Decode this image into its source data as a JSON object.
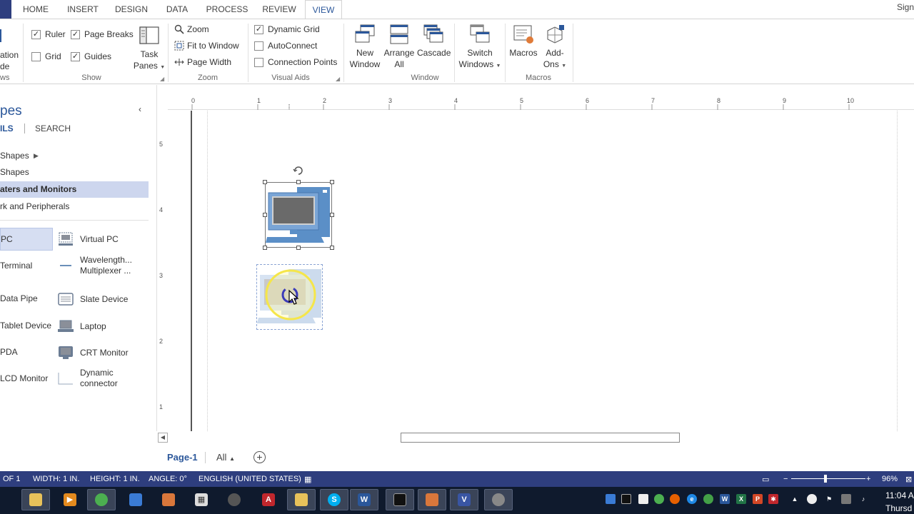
{
  "tabs": [
    {
      "label": "HOME",
      "active": false
    },
    {
      "label": "INSERT",
      "active": false
    },
    {
      "label": "DESIGN",
      "active": false
    },
    {
      "label": "DATA",
      "active": false
    },
    {
      "label": "PROCESS",
      "active": false
    },
    {
      "label": "REVIEW",
      "active": false
    },
    {
      "label": "VIEW",
      "active": true
    }
  ],
  "signin_label": "Sign",
  "ribbon": {
    "views_partial_1": "ation",
    "views_partial_2": "de",
    "views_group": "ws",
    "show": {
      "ruler": "Ruler",
      "page_breaks": "Page Breaks",
      "grid": "Grid",
      "guides": "Guides",
      "task_panes_1": "Task",
      "task_panes_2": "Panes",
      "group": "Show"
    },
    "zoom": {
      "zoom": "Zoom",
      "fit_to_window": "Fit to Window",
      "page_width": "Page Width",
      "group": "Zoom"
    },
    "visual_aids": {
      "dynamic_grid": "Dynamic Grid",
      "autoconnect": "AutoConnect",
      "connection_points": "Connection Points",
      "group": "Visual Aids"
    },
    "window": {
      "new_window_1": "New",
      "new_window_2": "Window",
      "arrange_all_1": "Arrange",
      "arrange_all_2": "All",
      "cascade": "Cascade",
      "switch_windows_1": "Switch",
      "switch_windows_2": "Windows",
      "group": "Window"
    },
    "macros": {
      "macros": "Macros",
      "addons_1": "Add-",
      "addons_2": "Ons",
      "group": "Macros"
    }
  },
  "shapes_pane": {
    "title": "pes",
    "tab_more": "ILS",
    "tab_search": "SEARCH",
    "stencils": [
      {
        "label": "Shapes",
        "active": false
      },
      {
        "label": "Shapes",
        "active": false
      },
      {
        "label": "aters and Monitors",
        "active": true
      },
      {
        "label": "rk and Peripherals",
        "active": false
      }
    ],
    "masters": [
      {
        "label": "PC"
      },
      {
        "label": "Virtual PC"
      },
      {
        "label": "Terminal"
      },
      {
        "label": "Wavelength...",
        "label2": "Multiplexer ..."
      },
      {
        "label": "Data Pipe"
      },
      {
        "label": "Slate Device"
      },
      {
        "label": "Tablet Device"
      },
      {
        "label": "Laptop"
      },
      {
        "label": "PDA"
      },
      {
        "label": "CRT Monitor"
      },
      {
        "label": "LCD Monitor"
      },
      {
        "label": "Dynamic",
        "label2": "connector"
      }
    ]
  },
  "ruler": {
    "h_ticks": [
      "0",
      "1",
      "2",
      "3",
      "4",
      "5",
      "6",
      "7",
      "8",
      "9",
      "10"
    ],
    "v_ticks": [
      "5",
      "4",
      "3",
      "2",
      "1"
    ]
  },
  "page_tabs": {
    "page": "Page-1",
    "all": "All",
    "add_symbol": "+"
  },
  "status": {
    "page_of": "OF 1",
    "width": "WIDTH: 1 IN.",
    "height": "HEIGHT: 1 IN.",
    "angle": "ANGLE: 0°",
    "language": "ENGLISH (UNITED STATES)",
    "zoom_level": "96%"
  },
  "taskbar": {
    "time": "11:04 A",
    "day": "Thursd"
  },
  "colors": {
    "accent": "#2b579a",
    "statusbar": "#2e3e7e",
    "stencil_active": "#cdd6ee",
    "taskbar": "#0f1a2d",
    "pc_icon": "#5b8fc7"
  }
}
